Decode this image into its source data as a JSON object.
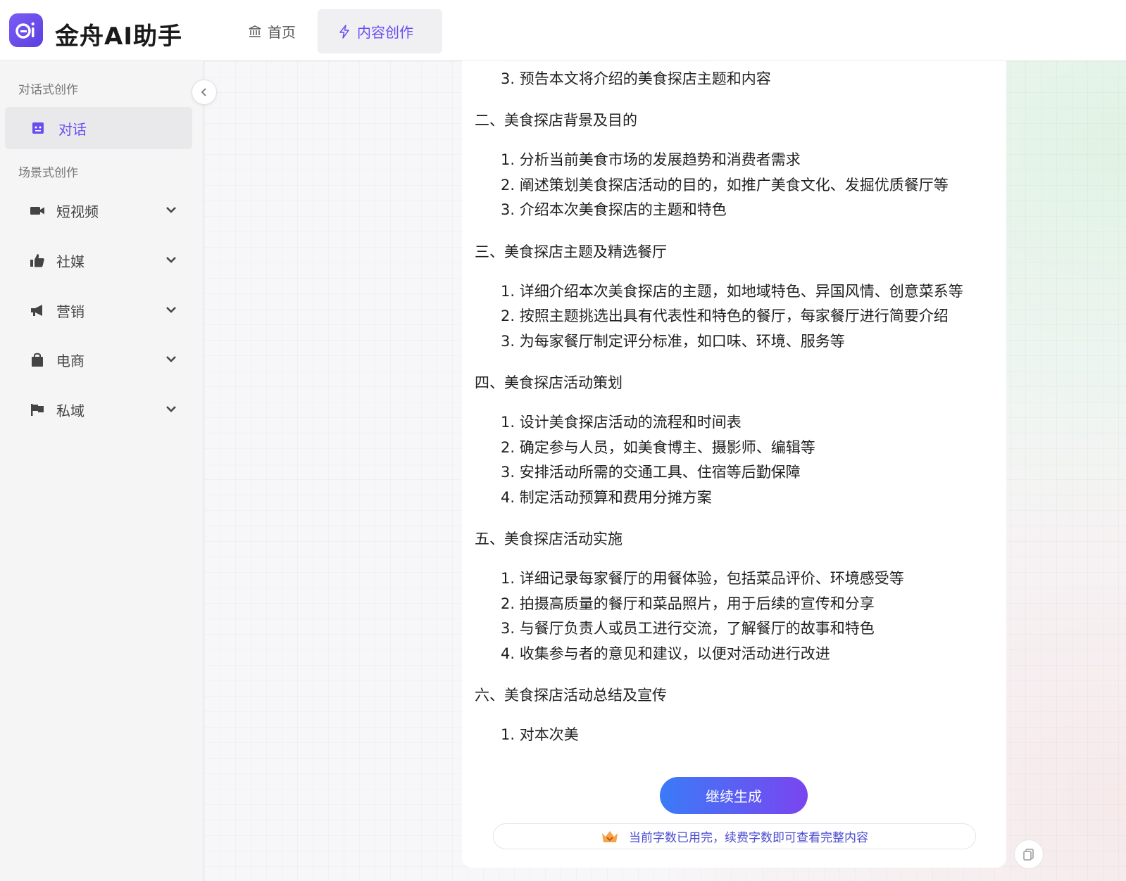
{
  "app": {
    "title": "金舟AI助手"
  },
  "nav": {
    "home_label": "首页",
    "create_label": "内容创作"
  },
  "sidebar": {
    "section_chat": "对话式创作",
    "chat_item": "对话",
    "section_scene": "场景式创作",
    "items": [
      {
        "label": "短视频",
        "icon": "video-camera-icon"
      },
      {
        "label": "社媒",
        "icon": "thumbs-up-icon"
      },
      {
        "label": "营销",
        "icon": "megaphone-icon"
      },
      {
        "label": "电商",
        "icon": "shopping-bag-icon"
      },
      {
        "label": "私域",
        "icon": "flag-icon"
      }
    ]
  },
  "content": {
    "intro_item": "3. 预告本文将介绍的美食探店主题和内容",
    "sections": [
      {
        "heading": "二、美食探店背景及目的",
        "items": [
          "1. 分析当前美食市场的发展趋势和消费者需求",
          "2. 阐述策划美食探店活动的目的，如推广美食文化、发掘优质餐厅等",
          "3. 介绍本次美食探店的主题和特色"
        ]
      },
      {
        "heading": "三、美食探店主题及精选餐厅",
        "items": [
          "1. 详细介绍本次美食探店的主题，如地域特色、异国风情、创意菜系等",
          "2. 按照主题挑选出具有代表性和特色的餐厅，每家餐厅进行简要介绍",
          "3. 为每家餐厅制定评分标准，如口味、环境、服务等"
        ]
      },
      {
        "heading": "四、美食探店活动策划",
        "items": [
          "1. 设计美食探店活动的流程和时间表",
          "2. 确定参与人员，如美食博主、摄影师、编辑等",
          "3. 安排活动所需的交通工具、住宿等后勤保障",
          "4. 制定活动预算和费用分摊方案"
        ]
      },
      {
        "heading": "五、美食探店活动实施",
        "items": [
          "1. 详细记录每家餐厅的用餐体验，包括菜品评价、环境感受等",
          "2. 拍摄高质量的餐厅和菜品照片，用于后续的宣传和分享",
          "3. 与餐厅负责人或员工进行交流，了解餐厅的故事和特色",
          "4. 收集参与者的意见和建议，以便对活动进行改进"
        ]
      },
      {
        "heading": "六、美食探店活动总结及宣传",
        "items": [
          "1. 对本次美"
        ]
      }
    ]
  },
  "actions": {
    "continue_label": "继续生成",
    "quota_text": "当前字数已用完，续费字数即可查看完整内容"
  },
  "colors": {
    "accent": "#6a4ff0",
    "button_gradient_start": "#3b7bf7",
    "button_gradient_end": "#7a45f0"
  }
}
